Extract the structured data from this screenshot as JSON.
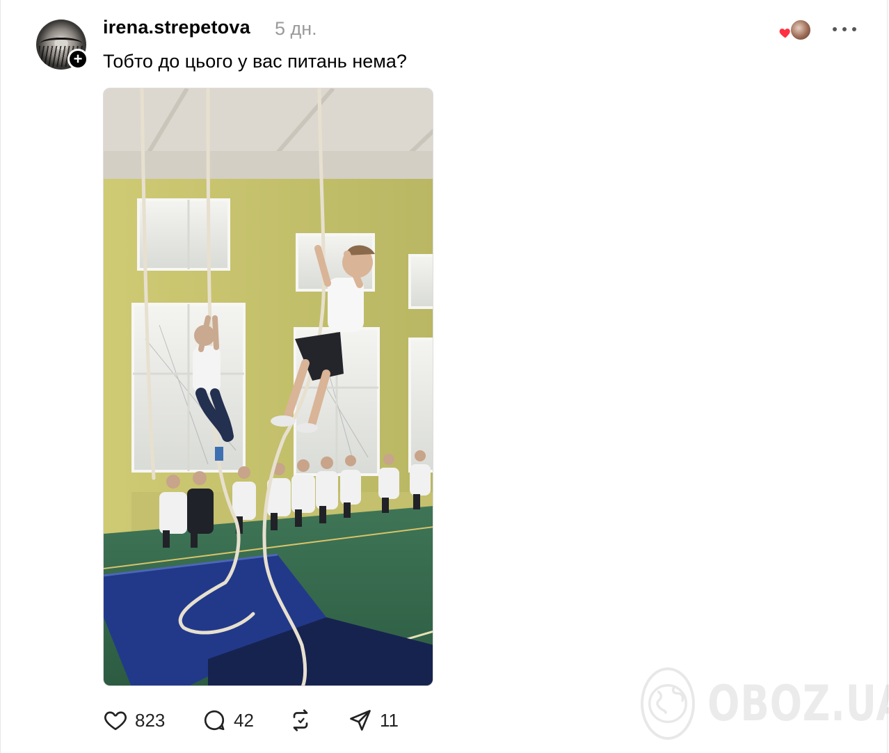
{
  "post": {
    "username": "irena.strepetova",
    "timestamp": "5 дн.",
    "text": "Тобто до цього у вас питань нема?",
    "image_alt": "Діти лазять по канату у шкільному спортзалі"
  },
  "actions": {
    "likes": "823",
    "comments": "42",
    "shares": "11"
  },
  "watermark": {
    "text": "OBOZ.UA"
  },
  "colors": {
    "heart": "#ff3040",
    "muted": "#9a9a9a",
    "accent": "#000000"
  },
  "icons": {
    "follow": "plus-icon",
    "more": "ellipsis-icon",
    "like": "heart-icon",
    "comment": "comment-icon",
    "repost": "repost-icon",
    "share": "share-icon"
  }
}
